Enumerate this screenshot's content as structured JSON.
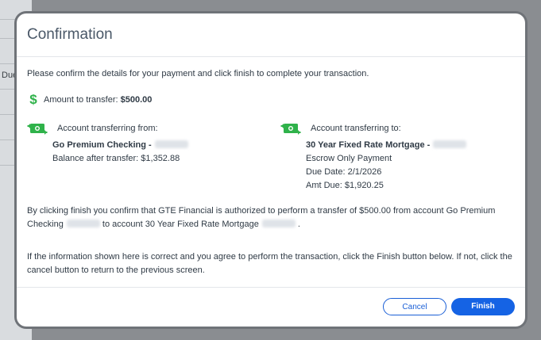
{
  "background": {
    "partial_label": "Due"
  },
  "modal": {
    "title": "Confirmation",
    "intro": "Please confirm the details for your payment and click finish to complete your transaction.",
    "amount_label": "Amount to transfer:",
    "amount_value": "$500.00",
    "from": {
      "heading": "Account transferring from:",
      "account_name": "Go Premium Checking -",
      "balance": "Balance after transfer: $1,352.88"
    },
    "to": {
      "heading": "Account transferring to:",
      "account_name": "30 Year Fixed Rate Mortgage -",
      "payment_type": "Escrow Only Payment",
      "due_date": "Due Date: 2/1/2026",
      "amt_due": "Amt Due: $1,920.25"
    },
    "authorization_line1": "By clicking finish you confirm that GTE Financial is authorized to perform a transfer of $500.00 from account Go Premium",
    "authorization_line2a": "Checking",
    "authorization_line2b": "to account 30 Year Fixed Rate Mortgage",
    "authorization_line2c": ".",
    "instruction_line1": "If the information shown here is correct and you agree to perform the transaction, click the Finish button below. If not, click the",
    "instruction_line2": "cancel button to return to the previous screen.",
    "cancel_label": "Cancel",
    "finish_label": "Finish"
  },
  "colors": {
    "accent": "#1563e4",
    "money_green": "#2fb24a"
  },
  "icons": {
    "amount": "dollar-icon",
    "accounts": "money-transfer-icon"
  }
}
